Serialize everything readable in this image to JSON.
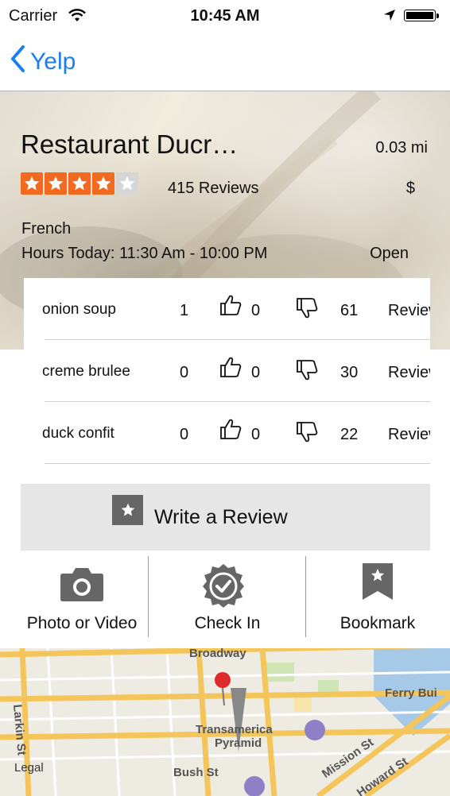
{
  "status_bar": {
    "carrier": "Carrier",
    "time": "10:45 AM"
  },
  "nav": {
    "back_label": "Yelp"
  },
  "restaurant": {
    "name": "Restaurant Ducr…",
    "distance": "0.03 mi",
    "rating_stars": 4,
    "rating_max": 5,
    "reviews": "415 Reviews",
    "price": "$",
    "category": "French",
    "hours": "Hours Today: 11:30 Am - 10:00 PM",
    "open_status": "Open"
  },
  "dishes": [
    {
      "name": "onion soup",
      "qty": "1",
      "thumbs_up": "0",
      "count": "61",
      "reviews": "Reviews"
    },
    {
      "name": "creme brulee",
      "qty": "0",
      "thumbs_up": "0",
      "count": "30",
      "reviews": "Reviews"
    },
    {
      "name": "duck confit",
      "qty": "0",
      "thumbs_up": "0",
      "count": "22",
      "reviews": "Reviews"
    }
  ],
  "write_review": {
    "label": "Write a Review",
    "icon": "star-icon"
  },
  "actions": [
    {
      "label": "Photo or Video",
      "icon": "camera-icon"
    },
    {
      "label": "Check In",
      "icon": "checkin-badge-icon"
    },
    {
      "label": "Bookmark",
      "icon": "bookmark-icon"
    }
  ],
  "map": {
    "legal": "Legal",
    "labels": [
      "Broadway",
      "Larkin St",
      "Transamerica",
      "Pyramid",
      "Ferry Bui",
      "Mission St",
      "Howard St",
      "Bush St"
    ]
  },
  "colors": {
    "accent": "#1a7ff7",
    "star": "#f26a1d",
    "star_off": "#d6d6d6",
    "button_bg": "#e6e6e6"
  }
}
